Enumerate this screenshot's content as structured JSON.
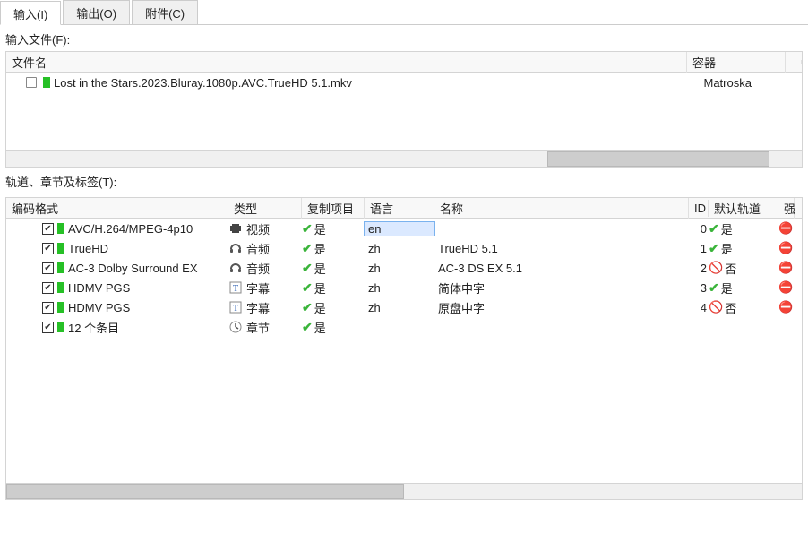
{
  "tabs": {
    "input": "输入(I)",
    "output": "输出(O)",
    "attach": "附件(C)"
  },
  "labels": {
    "inputFiles": "输入文件(F):",
    "tracksSection": "轨道、章节及标签(T):",
    "fileHeader": {
      "name": "文件名",
      "container": "容器"
    },
    "tracksHeader": {
      "codec": "编码格式",
      "type": "类型",
      "copy": "复制项目",
      "lang": "语言",
      "name": "名称",
      "id": "ID",
      "def": "默认轨道",
      "ext": "强"
    }
  },
  "files": [
    {
      "name": "Lost in the Stars.2023.Bluray.1080p.AVC.TrueHD 5.1.mkv",
      "container": "Matroska"
    }
  ],
  "typeLabels": {
    "video": "视频",
    "audio": "音频",
    "subtitle": "字幕",
    "chapter": "章节"
  },
  "yes": "是",
  "no": "否",
  "tracks": [
    {
      "codec": "AVC/H.264/MPEG-4p10",
      "type": "video",
      "copy": true,
      "lang": "en",
      "langSelected": true,
      "name": "",
      "id": "0",
      "def": true
    },
    {
      "codec": "TrueHD",
      "type": "audio",
      "copy": true,
      "lang": "zh",
      "name": "TrueHD 5.1",
      "id": "1",
      "def": true
    },
    {
      "codec": "AC-3 Dolby Surround EX",
      "type": "audio",
      "copy": true,
      "lang": "zh",
      "name": "AC-3 DS EX 5.1",
      "id": "2",
      "def": false
    },
    {
      "codec": "HDMV PGS",
      "type": "subtitle",
      "copy": true,
      "lang": "zh",
      "name": "简体中字",
      "id": "3",
      "def": true
    },
    {
      "codec": "HDMV PGS",
      "type": "subtitle",
      "copy": true,
      "lang": "zh",
      "name": "原盘中字",
      "id": "4",
      "def": false
    },
    {
      "codec": "12 个条目",
      "type": "chapter",
      "copy": true,
      "lang": "",
      "name": "",
      "id": "",
      "def": null
    }
  ]
}
